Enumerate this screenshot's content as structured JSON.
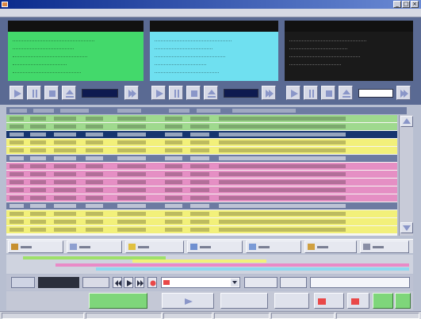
{
  "window": {
    "title": "",
    "buttons": {
      "minimize": "_",
      "maximize": "□",
      "close": "×"
    }
  },
  "menu": {
    "items": [
      "",
      "",
      "",
      "",
      "",
      "",
      "",
      ""
    ]
  },
  "players": [
    {
      "id": "player-1",
      "accent": "#43d96b",
      "times": [
        {
          "value": "",
          "color": "#3cf07a"
        },
        {
          "value": "",
          "color": "#33e0ff"
        },
        {
          "value": "",
          "color": "#ff4a3c"
        }
      ],
      "info_lines": 5
    },
    {
      "id": "player-2",
      "accent": "#6fe0f0",
      "times": [
        {
          "value": "",
          "color": "#ff4a3c"
        },
        {
          "value": "",
          "color": "#33e0ff"
        },
        {
          "value": "",
          "color": "#ff4a3c"
        }
      ],
      "info_lines": 5
    },
    {
      "id": "player-3",
      "accent": "#1a1a1a",
      "times": [
        {
          "value": "",
          "color": "#3cf07a"
        },
        {
          "value": "",
          "color": "#ff4a3c"
        }
      ],
      "info_lines": 4
    }
  ],
  "playlist": {
    "rows": [
      {
        "color": "#9fd98e",
        "dark": false
      },
      {
        "color": "#9fd98e",
        "dark": false
      },
      {
        "color": "#16356f",
        "dark": true
      },
      {
        "color": "#f2f07a",
        "dark": false
      },
      {
        "color": "#f2f07a",
        "dark": false
      },
      {
        "color": "#6d7ba2",
        "dark": true
      },
      {
        "color": "#e58fc4",
        "dark": false
      },
      {
        "color": "#e58fc4",
        "dark": false
      },
      {
        "color": "#e58fc4",
        "dark": false
      },
      {
        "color": "#e58fc4",
        "dark": false
      },
      {
        "color": "#e58fc4",
        "dark": false
      },
      {
        "color": "#6d7ba2",
        "dark": true
      },
      {
        "color": "#f2f07a",
        "dark": false
      },
      {
        "color": "#f2f07a",
        "dark": false
      },
      {
        "color": "#f2f07a",
        "dark": false
      }
    ]
  },
  "toolbar": {
    "buttons": [
      {
        "name": "tool-button-1",
        "icon": "folder-icon",
        "icon_color": "#c79030"
      },
      {
        "name": "tool-button-2",
        "icon": "document-icon",
        "icon_color": "#8fa0d0"
      },
      {
        "name": "tool-button-3",
        "icon": "note-icon",
        "icon_color": "#e0c040"
      },
      {
        "name": "tool-button-4",
        "icon": "grid-icon",
        "icon_color": "#6f8fd0"
      },
      {
        "name": "tool-button-5",
        "icon": "list-icon",
        "icon_color": "#7a9ad6"
      },
      {
        "name": "tool-button-6",
        "icon": "chart-icon",
        "icon_color": "#d0a040"
      },
      {
        "name": "tool-button-7",
        "icon": "settings-icon",
        "icon_color": "#8a8fa6"
      }
    ]
  },
  "timeline": {
    "bars": [
      {
        "color": "#9ee06a",
        "start": 0.04,
        "end": 0.39
      },
      {
        "color": "#f2f07a",
        "start": 0.31,
        "end": 0.64
      },
      {
        "color": "#e98ac7",
        "start": 0.12,
        "end": 0.45
      },
      {
        "color": "#e98ac7",
        "start": 0.45,
        "end": 0.99
      },
      {
        "color": "#8fd8f0",
        "start": 0.22,
        "end": 0.99
      }
    ]
  },
  "colors": {
    "green_button": "#7ed67a",
    "red_accent": "#e94848"
  }
}
